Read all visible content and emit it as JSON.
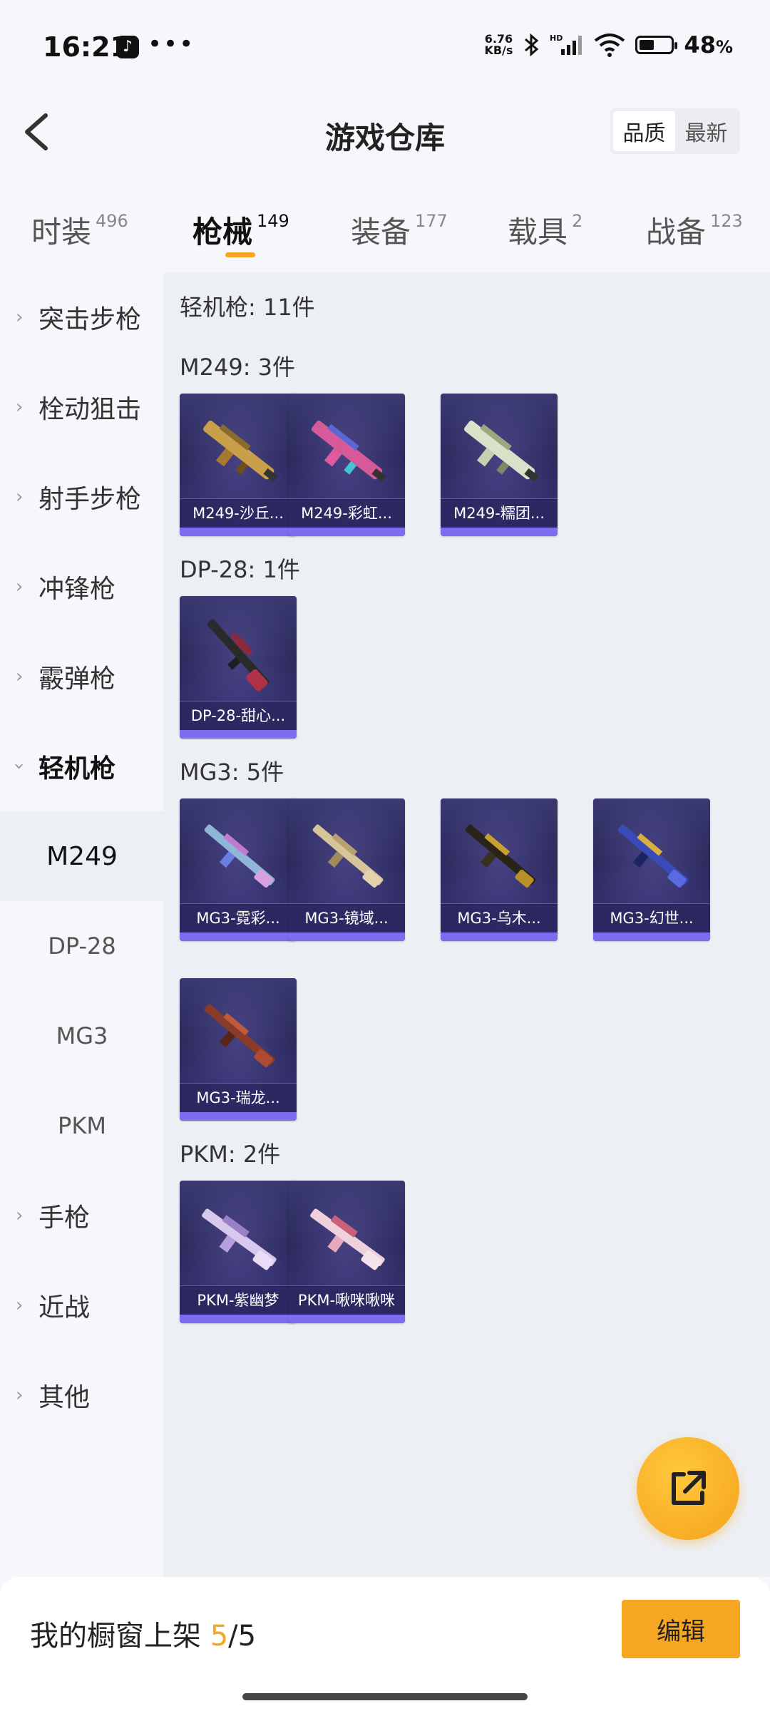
{
  "status_bar": {
    "time": "16:21",
    "net_speed_top": "6.76",
    "net_speed_bottom": "KB/s",
    "battery_pct": "48",
    "battery_unit": "%",
    "battery_level": 0.48,
    "hd_label": "HD"
  },
  "header": {
    "title": "游戏仓库",
    "sort_options": [
      "品质",
      "最新"
    ],
    "sort_selected": "品质"
  },
  "tabs": [
    {
      "label": "时装",
      "count": "496",
      "active": false
    },
    {
      "label": "枪械",
      "count": "149",
      "active": true
    },
    {
      "label": "装备",
      "count": "177",
      "active": false
    },
    {
      "label": "载具",
      "count": "2",
      "active": false
    },
    {
      "label": "战备",
      "count": "123",
      "active": false
    }
  ],
  "sidebar": {
    "categories": [
      {
        "label": "突击步枪",
        "expanded": false
      },
      {
        "label": "栓动狙击",
        "expanded": false
      },
      {
        "label": "射手步枪",
        "expanded": false
      },
      {
        "label": "冲锋枪",
        "expanded": false
      },
      {
        "label": "霰弹枪",
        "expanded": false
      },
      {
        "label": "轻机枪",
        "expanded": true
      },
      {
        "label": "手枪",
        "expanded": false
      },
      {
        "label": "近战",
        "expanded": false
      },
      {
        "label": "其他",
        "expanded": false
      }
    ],
    "subcategories": [
      {
        "label": "M249",
        "active": true
      },
      {
        "label": "DP-28",
        "active": false
      },
      {
        "label": "MG3",
        "active": false
      },
      {
        "label": "PKM",
        "active": false
      }
    ]
  },
  "content": {
    "total_label": "轻机枪: 11件",
    "groups": [
      {
        "title": "M249: 3件",
        "items": [
          "M249-沙丘...",
          "M249-彩虹...",
          "M249-糯团..."
        ]
      },
      {
        "title": "DP-28: 1件",
        "items": [
          "DP-28-甜心..."
        ]
      },
      {
        "title": "MG3: 5件",
        "items": [
          "MG3-霓彩...",
          "MG3-镜域...",
          "MG3-乌木...",
          "MG3-幻世...",
          "MG3-瑞龙..."
        ]
      },
      {
        "title": "PKM: 2件",
        "items": [
          "PKM-紫幽梦",
          "PKM-啾咪啾咪"
        ]
      }
    ]
  },
  "footer": {
    "showcase_label": "我的橱窗上架",
    "showcase_current": "5",
    "showcase_sep": "/",
    "showcase_total": "5",
    "edit_label": "编辑"
  },
  "colors": {
    "accent": "#f5a623",
    "card_bg": "#2b2a5c",
    "card_strip": "#7d6cf0",
    "content_bg": "#eceff3"
  },
  "icons": {
    "back": "chevron-left-icon",
    "fab": "share-external-icon",
    "tiktok": "tiktok-icon"
  }
}
